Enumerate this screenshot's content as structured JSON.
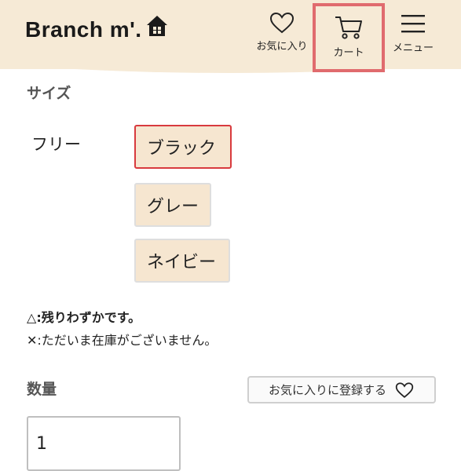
{
  "header": {
    "logo_text": "Branch m'.",
    "nav": {
      "favorites_label": "お気に入り",
      "cart_label": "カート",
      "menu_label": "メニュー"
    }
  },
  "size": {
    "title": "サイズ",
    "label": "フリー",
    "options": [
      {
        "label": "ブラック",
        "selected": true
      },
      {
        "label": "グレー",
        "selected": false
      },
      {
        "label": "ネイビー",
        "selected": false
      }
    ],
    "notes": [
      {
        "symbol": "△",
        "text": ":残りわずかです。"
      },
      {
        "symbol": "✕",
        "text": ":ただいま在庫がございません。"
      }
    ]
  },
  "quantity": {
    "title": "数量",
    "value": "1",
    "favorite_button_label": "お気に入りに登録する"
  },
  "colors": {
    "header_bg": "#f6ead6",
    "option_bg": "#f6e6d0",
    "highlight_border": "#e06b6e",
    "selected_border": "#d83a3e"
  },
  "icons": {
    "logo": "house-icon",
    "favorites": "heart-icon",
    "cart": "cart-icon",
    "menu": "hamburger-icon",
    "favorite_button": "heart-icon"
  }
}
